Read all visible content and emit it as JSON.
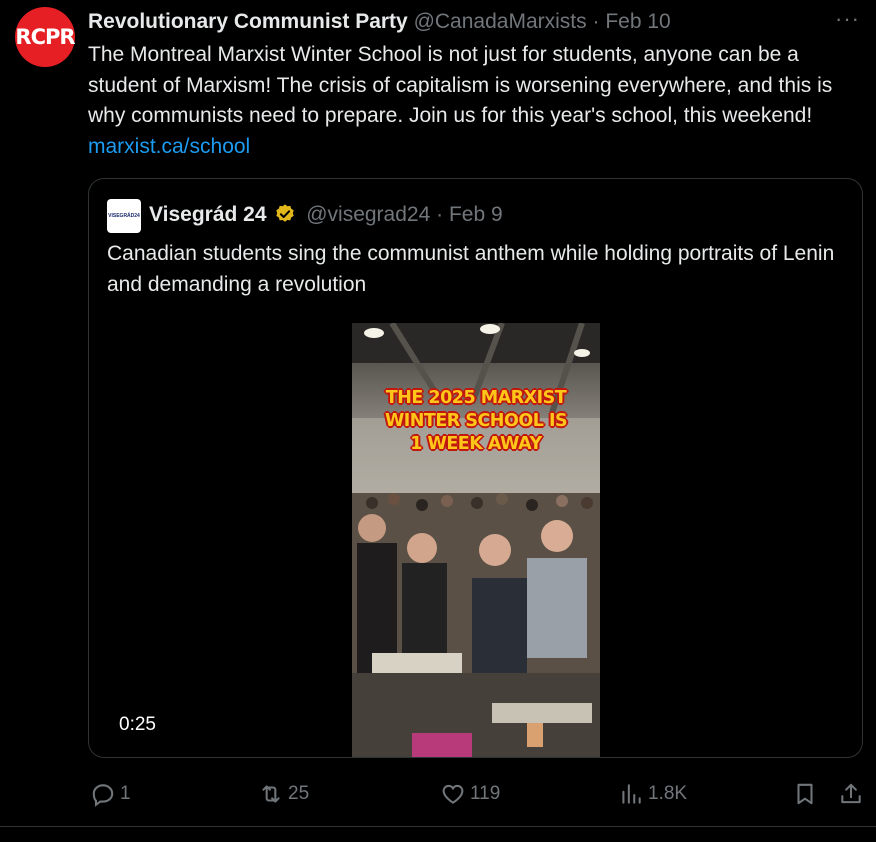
{
  "post": {
    "avatar_text": "RCPR",
    "author_name": "Revolutionary Communist Party",
    "handle": "@CanadaMarxists",
    "date": "Feb 10",
    "more": "···",
    "text": "The Montreal Marxist Winter School is not just for students, anyone can be a student of Marxism! The crisis of capitalism is worsening everywhere, and this is why communists need to prepare. Join us for this year's school, this weekend! ",
    "link": "marxist.ca/school"
  },
  "quote": {
    "avatar_text": "VISEGRÁD24",
    "author_name": "Visegrád 24",
    "handle": "@visegrad24",
    "date": "Feb 9",
    "text": "Canadian students sing the communist anthem while holding portraits of Lenin and demanding a revolution",
    "video_overlay": [
      "THE 2025 MARXIST",
      "WINTER SCHOOL IS",
      "1 WEEK AWAY"
    ],
    "duration": "0:25"
  },
  "actions": {
    "replies": "1",
    "reposts": "25",
    "likes": "119",
    "views": "1.8K"
  },
  "colors": {
    "accent": "#1d9bf0",
    "muted": "#71767b",
    "avatar_red": "#e51f24",
    "verified_gold": "#e2b719"
  }
}
